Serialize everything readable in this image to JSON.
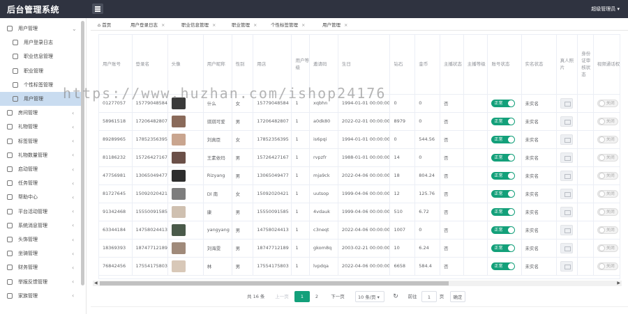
{
  "app": {
    "title": "后台管理系统",
    "admin_name": "超级管理员"
  },
  "sidebar": {
    "items": [
      {
        "label": "用户管理",
        "arrow": "⌄",
        "sub": false,
        "active": false
      },
      {
        "label": "用户登录日志",
        "arrow": "",
        "sub": true,
        "active": false
      },
      {
        "label": "职业信息管理",
        "arrow": "",
        "sub": true,
        "active": false
      },
      {
        "label": "职业管理",
        "arrow": "",
        "sub": true,
        "active": false
      },
      {
        "label": "个性标签管理",
        "arrow": "",
        "sub": true,
        "active": false
      },
      {
        "label": "用户管理",
        "arrow": "",
        "sub": true,
        "active": true
      },
      {
        "label": "房间管理",
        "arrow": "‹",
        "sub": false,
        "active": false
      },
      {
        "label": "礼物管理",
        "arrow": "‹",
        "sub": false,
        "active": false
      },
      {
        "label": "标签管理",
        "arrow": "‹",
        "sub": false,
        "active": false
      },
      {
        "label": "礼物数量管理",
        "arrow": "‹",
        "sub": false,
        "active": false
      },
      {
        "label": "启动管理",
        "arrow": "‹",
        "sub": false,
        "active": false
      },
      {
        "label": "任务管理",
        "arrow": "‹",
        "sub": false,
        "active": false
      },
      {
        "label": "帮助中心",
        "arrow": "‹",
        "sub": false,
        "active": false
      },
      {
        "label": "平台活动管理",
        "arrow": "‹",
        "sub": false,
        "active": false
      },
      {
        "label": "系统消息管理",
        "arrow": "‹",
        "sub": false,
        "active": false
      },
      {
        "label": "头饰管理",
        "arrow": "‹",
        "sub": false,
        "active": false
      },
      {
        "label": "坐骑管理",
        "arrow": "‹",
        "sub": false,
        "active": false
      },
      {
        "label": "财务管理",
        "arrow": "‹",
        "sub": false,
        "active": false
      },
      {
        "label": "举报反馈管理",
        "arrow": "‹",
        "sub": false,
        "active": false
      },
      {
        "label": "家族管理",
        "arrow": "‹",
        "sub": false,
        "active": false
      }
    ]
  },
  "tabs": [
    {
      "label": "首页",
      "close": ""
    },
    {
      "label": "用户登录日志",
      "close": "×"
    },
    {
      "label": "职业信息管理",
      "close": "×"
    },
    {
      "label": "职业管理",
      "close": "×"
    },
    {
      "label": "个性标签管理",
      "close": "×"
    },
    {
      "label": "用户管理",
      "close": "×"
    }
  ],
  "table": {
    "headers": [
      "用户账号",
      "登录名",
      "头像",
      "用户昵称",
      "性别",
      "用店",
      "用户等级",
      "邀请码",
      "生日",
      "钻石",
      "金币",
      "主播状态",
      "主播等级",
      "账号状态",
      "实名状态",
      "真人照片",
      "身份证审核状态",
      "视频通话权限"
    ],
    "rows": [
      {
        "account": "01277057",
        "login": "15779048584",
        "nick": "什么",
        "gender": "女",
        "phone": "15779048584",
        "level": "1",
        "invite": "xqbhn",
        "birthday": "1994-01-01 00:00:00",
        "diamond": "0",
        "coin": "0",
        "anchor": "否",
        "anchor_level": "",
        "status": "正常",
        "real": "未实名",
        "video": "关闭",
        "avatar": "#3a3a3a"
      },
      {
        "account": "58961518",
        "login": "17206482807",
        "nick": "琪琪可爱",
        "gender": "男",
        "phone": "17206482807",
        "level": "1",
        "invite": "a0dk80",
        "birthday": "2022-02-01 00:00:00",
        "diamond": "8979",
        "coin": "0",
        "anchor": "否",
        "anchor_level": "",
        "status": "正常",
        "real": "未实名",
        "video": "关闭",
        "avatar": "#8a6a5a"
      },
      {
        "account": "89289965",
        "login": "17852356395",
        "nick": "刘真臣",
        "gender": "女",
        "phone": "17852356395",
        "level": "1",
        "invite": "is6pqi",
        "birthday": "1994-01-01 00:00:00",
        "diamond": "0",
        "coin": "544.56",
        "anchor": "否",
        "anchor_level": "",
        "status": "正常",
        "real": "未实名",
        "video": "关闭",
        "avatar": "#c9a58f"
      },
      {
        "account": "81186232",
        "login": "15726427167",
        "nick": "王素依玛",
        "gender": "男",
        "phone": "15726427167",
        "level": "1",
        "invite": "rvpzfr",
        "birthday": "1988-01-01 00:00:00",
        "diamond": "14",
        "coin": "0",
        "anchor": "否",
        "anchor_level": "",
        "status": "正常",
        "real": "未实名",
        "video": "关闭",
        "avatar": "#6b5048"
      },
      {
        "account": "47756981",
        "login": "13065049477",
        "nick": "Rizyang",
        "gender": "男",
        "phone": "13065049477",
        "level": "1",
        "invite": "mja9ck",
        "birthday": "2022-04-06 00:00:00",
        "diamond": "18",
        "coin": "804.24",
        "anchor": "否",
        "anchor_level": "",
        "status": "正常",
        "real": "未实名",
        "video": "关闭",
        "avatar": "#2d2d2d"
      },
      {
        "account": "81727645",
        "login": "15092020421",
        "nick": "Dl 南",
        "gender": "女",
        "phone": "15092020421",
        "level": "1",
        "invite": "uutsop",
        "birthday": "1999-04-06 00:00:00",
        "diamond": "12",
        "coin": "125.76",
        "anchor": "否",
        "anchor_level": "",
        "status": "正常",
        "real": "未实名",
        "video": "关闭",
        "avatar": "#7d7d7d"
      },
      {
        "account": "91342468",
        "login": "15550091585",
        "nick": "康",
        "gender": "男",
        "phone": "15550091585",
        "level": "1",
        "invite": "4vdauk",
        "birthday": "1999-04-06 00:00:00",
        "diamond": "510",
        "coin": "6.72",
        "anchor": "否",
        "anchor_level": "",
        "status": "正常",
        "real": "未实名",
        "video": "关闭",
        "avatar": "#cfc0b0"
      },
      {
        "account": "63344184",
        "login": "14758024413",
        "nick": "yangyang",
        "gender": "男",
        "phone": "14758024413",
        "level": "1",
        "invite": "c3neqt",
        "birthday": "2022-04-06 00:00:00",
        "diamond": "1007",
        "coin": "0",
        "anchor": "否",
        "anchor_level": "",
        "status": "正常",
        "real": "未实名",
        "video": "关闭",
        "avatar": "#4a5a4a"
      },
      {
        "account": "18369393",
        "login": "18747712189",
        "nick": "刘海雯",
        "gender": "男",
        "phone": "18747712189",
        "level": "1",
        "invite": "gkom8q",
        "birthday": "2003-02-21 00:00:00",
        "diamond": "10",
        "coin": "6.24",
        "anchor": "否",
        "anchor_level": "",
        "status": "正常",
        "real": "未实名",
        "video": "关闭",
        "avatar": "#a08a7a"
      },
      {
        "account": "76842456",
        "login": "17554175803",
        "nick": "林",
        "gender": "男",
        "phone": "17554175803",
        "level": "1",
        "invite": "lvpdqa",
        "birthday": "2022-04-06 00:00:00",
        "diamond": "6658",
        "coin": "584.4",
        "anchor": "否",
        "anchor_level": "",
        "status": "正常",
        "real": "未实名",
        "video": "关闭",
        "avatar": "#d8c8b8"
      }
    ]
  },
  "pagination": {
    "total": "共 16 条",
    "prev": "上一页",
    "page1": "1",
    "page2": "2",
    "next": "下一页",
    "page_size": "10 条/页",
    "goto": "前往",
    "goto_value": "1",
    "page_unit": "页",
    "confirm": "确定"
  },
  "watermark": "https://www.huzhan.com/ishop24176",
  "colors": {
    "header": "#2f3340",
    "accent": "#13a07a",
    "sidebar_active": "#c9dcf0"
  }
}
